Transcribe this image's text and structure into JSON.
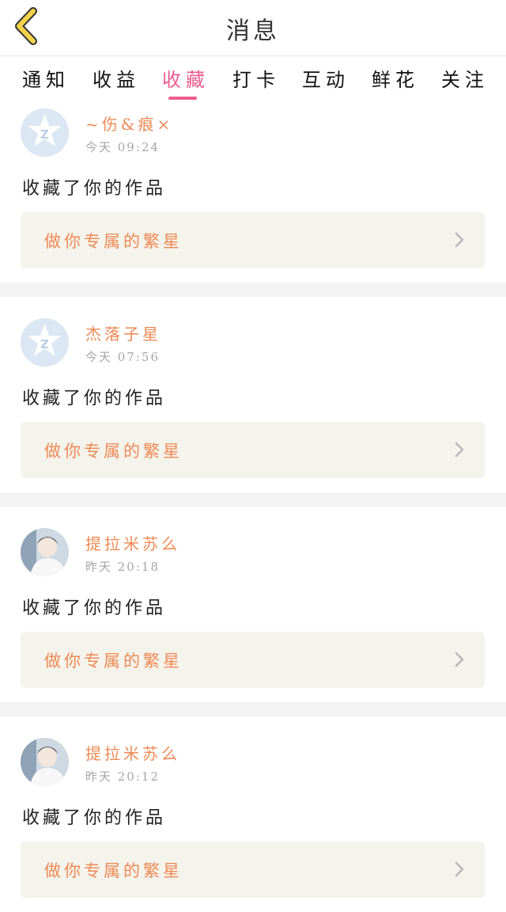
{
  "header": {
    "title": "消息"
  },
  "tabs": [
    {
      "label": "通知"
    },
    {
      "label": "收益"
    },
    {
      "label": "收藏"
    },
    {
      "label": "打卡"
    },
    {
      "label": "互动"
    },
    {
      "label": "鲜花"
    },
    {
      "label": "关注"
    }
  ],
  "active_tab": "收藏",
  "messages": [
    {
      "username": "~伤&痕×",
      "time": "今天 09:24",
      "action": "收藏了你的作品",
      "work_title": "做你专属的繁星",
      "avatar": "qq-default-avatar"
    },
    {
      "username": "杰落子星",
      "time": "今天 07:56",
      "action": "收藏了你的作品",
      "work_title": "做你专属的繁星",
      "avatar": "qq-default-avatar"
    },
    {
      "username": "提拉米苏么",
      "time": "昨天 20:18",
      "action": "收藏了你的作品",
      "work_title": "做你专属的繁星",
      "avatar": "photo-avatar"
    },
    {
      "username": "提拉米苏么",
      "time": "昨天 20:12",
      "action": "收藏了你的作品",
      "work_title": "做你专属的繁星",
      "avatar": "photo-avatar"
    }
  ],
  "colors": {
    "accent": "#ee5c8f",
    "username": "#ef8a55",
    "back_arrow": "#f2d24a",
    "card_bg": "#f4f3ec"
  }
}
